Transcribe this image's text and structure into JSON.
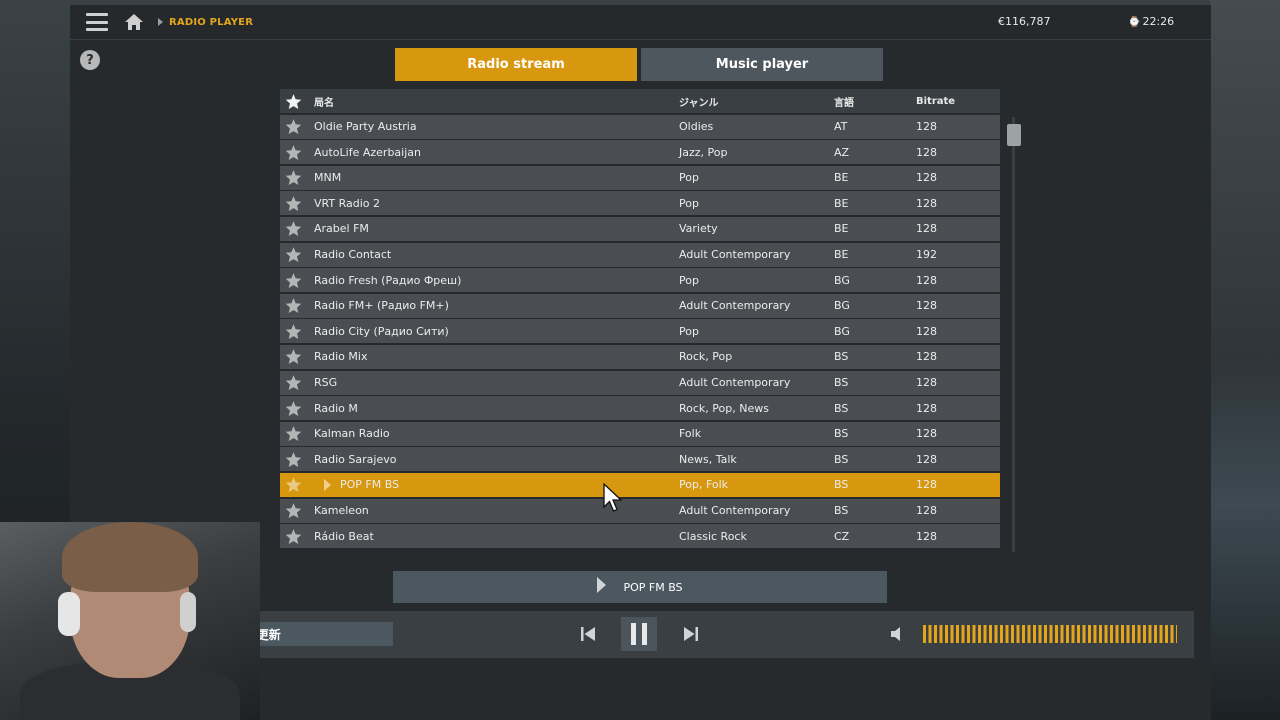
{
  "topbar": {
    "breadcrumb": "RADIO PLAYER",
    "money": "€116,787",
    "time": "22:26",
    "time_icon": "clock-icon"
  },
  "help_label": "?",
  "tabs": [
    {
      "label": "Radio stream",
      "active": true
    },
    {
      "label": "Music player",
      "active": false
    }
  ],
  "table": {
    "headers": {
      "name": "局名",
      "genre": "ジャンル",
      "lang": "言語",
      "bitrate": "Bitrate"
    },
    "rows": [
      {
        "name": "Oldie Party Austria",
        "genre": "Oldies",
        "lang": "AT",
        "bitrate": "128"
      },
      {
        "name": "AutoLife Azerbaijan",
        "genre": "Jazz, Pop",
        "lang": "AZ",
        "bitrate": "128"
      },
      {
        "name": "MNM",
        "genre": "Pop",
        "lang": "BE",
        "bitrate": "128"
      },
      {
        "name": "VRT Radio 2",
        "genre": "Pop",
        "lang": "BE",
        "bitrate": "128"
      },
      {
        "name": "Arabel FM",
        "genre": "Variety",
        "lang": "BE",
        "bitrate": "128"
      },
      {
        "name": "Radio Contact",
        "genre": "Adult Contemporary",
        "lang": "BE",
        "bitrate": "192"
      },
      {
        "name": "Radio Fresh (Радио Фреш)",
        "genre": "Pop",
        "lang": "BG",
        "bitrate": "128"
      },
      {
        "name": "Radio FM+ (Радио FM+)",
        "genre": "Adult Contemporary",
        "lang": "BG",
        "bitrate": "128"
      },
      {
        "name": "Radio City (Радио Сити)",
        "genre": "Pop",
        "lang": "BG",
        "bitrate": "128"
      },
      {
        "name": "Radio Mix",
        "genre": "Rock, Pop",
        "lang": "BS",
        "bitrate": "128"
      },
      {
        "name": "RSG",
        "genre": "Adult Contemporary",
        "lang": "BS",
        "bitrate": "128"
      },
      {
        "name": "Radio M",
        "genre": "Rock, Pop, News",
        "lang": "BS",
        "bitrate": "128"
      },
      {
        "name": "Kalman Radio",
        "genre": "Folk",
        "lang": "BS",
        "bitrate": "128"
      },
      {
        "name": "Radio Sarajevo",
        "genre": "News, Talk",
        "lang": "BS",
        "bitrate": "128"
      },
      {
        "name": "POP FM BS",
        "genre": "Pop, Folk",
        "lang": "BS",
        "bitrate": "128"
      },
      {
        "name": "Kameleon",
        "genre": "Adult Contemporary",
        "lang": "BS",
        "bitrate": "128"
      },
      {
        "name": "Rádio Beat",
        "genre": "Classic Rock",
        "lang": "CZ",
        "bitrate": "128"
      }
    ]
  },
  "selected_row": 14,
  "now_playing": "POP FM BS",
  "player": {
    "update_label": "ラジオを更新",
    "volume_level": 1.0
  },
  "colors": {
    "accent": "#d7980f",
    "row": "#4a4e52",
    "header": "#3a3f43",
    "panel": "#262a2d"
  }
}
